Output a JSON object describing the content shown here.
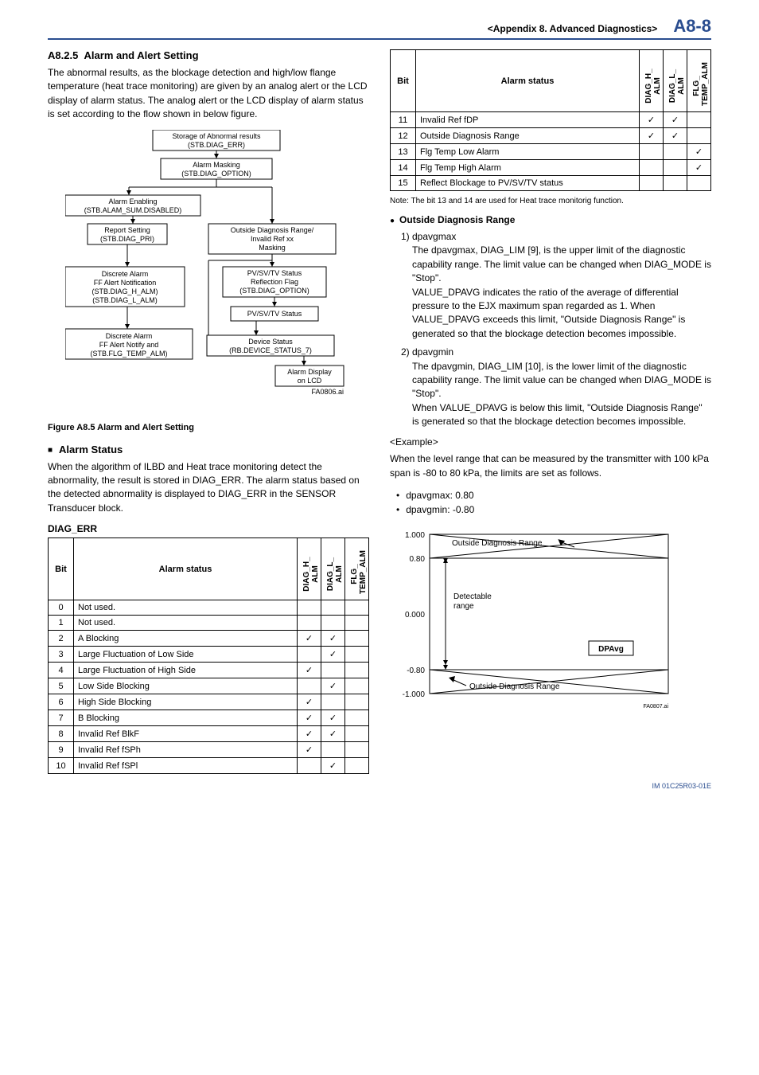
{
  "header": {
    "section": "<Appendix 8.  Advanced Diagnostics>",
    "page": "A8-8"
  },
  "section_no": "A8.2.5",
  "section_title": "Alarm and Alert Setting",
  "intro_para": "The abnormal results, as the blockage detection and high/low flange temperature (heat trace monitoring) are given by an analog alert or the LCD display of alarm status. The analog alert or the LCD display of alarm status is set according to the flow shown in below figure.",
  "flow": {
    "b1": "Storage of Abnormal results\n(STB.DIAG_ERR)",
    "b2": "Alarm Masking\n(STB.DIAG_OPTION)",
    "b3": "Alarm Enabling\n(STB.ALAM_SUM.DISABLED)",
    "b4": "Report Setting\n(STB.DIAG_PRI)",
    "b5": "Outside Diagnosis Range/\nInvalid Ref xx\nMasking",
    "b6": "Discrete Alarm\nFF Alert Notification\n(STB.DIAG_H_ALM)\n(STB.DIAG_L_ALM)",
    "b7": "PV/SV/TV Status\nReflection Flag\n(STB.DIAG_OPTION)",
    "b8": "PV/SV/TV Status",
    "b9": "Discrete Alarm\nFF Alert Notify and\n(STB.FLG_TEMP_ALM)",
    "b10": "Device Status\n(RB.DEVICE_STATUS_7)",
    "b11": "Alarm Display\non LCD",
    "cap": "FA0806.ai"
  },
  "fig_caption": "Figure A8.5    Alarm and Alert Setting",
  "alarm_status_head": "Alarm Status",
  "alarm_status_para": "When the algorithm of ILBD and Heat trace monitoring detect the abnormality, the result is stored in DIAG_ERR. The alarm status based on the detected abnormality is displayed to DIAG_ERR in the SENSOR Transducer block.",
  "diag_err_label": "DIAG_ERR",
  "table_headers": {
    "bit": "Bit",
    "status": "Alarm status",
    "c1": "DIAG_H_\nALM",
    "c2": "DIAG_L_\nALM",
    "c3": "FLG_\nTEMP_ALM"
  },
  "rows_left": [
    {
      "bit": "0",
      "status": "Not used.",
      "c1": "",
      "c2": "",
      "c3": ""
    },
    {
      "bit": "1",
      "status": "Not used.",
      "c1": "",
      "c2": "",
      "c3": ""
    },
    {
      "bit": "2",
      "status": "A Blocking",
      "c1": "✓",
      "c2": "✓",
      "c3": ""
    },
    {
      "bit": "3",
      "status": "Large Fluctuation of Low Side",
      "c1": "",
      "c2": "✓",
      "c3": ""
    },
    {
      "bit": "4",
      "status": "Large Fluctuation of High Side",
      "c1": "✓",
      "c2": "",
      "c3": ""
    },
    {
      "bit": "5",
      "status": "Low Side Blocking",
      "c1": "",
      "c2": "✓",
      "c3": ""
    },
    {
      "bit": "6",
      "status": "High Side Blocking",
      "c1": "✓",
      "c2": "",
      "c3": ""
    },
    {
      "bit": "7",
      "status": "B Blocking",
      "c1": "✓",
      "c2": "✓",
      "c3": ""
    },
    {
      "bit": "8",
      "status": "Invalid Ref BlkF",
      "c1": "✓",
      "c2": "✓",
      "c3": ""
    },
    {
      "bit": "9",
      "status": "Invalid Ref fSPh",
      "c1": "✓",
      "c2": "",
      "c3": ""
    },
    {
      "bit": "10",
      "status": "Invalid Ref fSPl",
      "c1": "",
      "c2": "✓",
      "c3": ""
    }
  ],
  "rows_right": [
    {
      "bit": "11",
      "status": "Invalid Ref fDP",
      "c1": "✓",
      "c2": "✓",
      "c3": ""
    },
    {
      "bit": "12",
      "status": "Outside Diagnosis Range",
      "c1": "✓",
      "c2": "✓",
      "c3": ""
    },
    {
      "bit": "13",
      "status": "Flg Temp Low Alarm",
      "c1": "",
      "c2": "",
      "c3": "✓"
    },
    {
      "bit": "14",
      "status": "Flg Temp High Alarm",
      "c1": "",
      "c2": "",
      "c3": "✓"
    },
    {
      "bit": "15",
      "status": "Reflect Blockage to PV/SV/TV status",
      "c1": "",
      "c2": "",
      "c3": ""
    }
  ],
  "note_text": "Note:  The bit 13 and 14 are used for Heat trace monitorig function.",
  "outside_head": "Outside Diagnosis Range",
  "odr_1_label": "1) dpavgmax",
  "odr_1_p1": "The dpavgmax, DIAG_LIM [9], is the upper limit of the diagnostic capability range. The limit value can be changed when DIAG_MODE is \"Stop\".",
  "odr_1_p2": "VALUE_DPAVG indicates the ratio of the average of differential pressure to the EJX maximum span regarded as 1. When VALUE_DPAVG exceeds this limit, \"Outside Diagnosis Range\" is generated so that the blockage detection becomes impossible.",
  "odr_2_label": "2) dpavgmin",
  "odr_2_p1": "The dpavgmin, DIAG_LIM [10], is the lower limit of the diagnostic capability range. The limit value can be changed when DIAG_MODE is \"Stop\".",
  "odr_2_p2": "When VALUE_DPAVG is below this limit, \"Outside Diagnosis Range\" is generated so that the blockage detection becomes impossible.",
  "example_label": "<Example>",
  "example_para": "When the level range that can be measured by the transmitter with 100 kPa span is -80 to 80 kPa, the limits are set as follows.",
  "example_bullets": [
    "dpavgmax: 0.80",
    "dpavgmin: -0.80"
  ],
  "chart_data": {
    "type": "diagram",
    "y_ticks": [
      "1.000",
      "0.80",
      "0.000",
      "-0.80",
      "-1.000"
    ],
    "labels": {
      "top": "Outside Diagnosis Range",
      "mid": "Detectable\nrange",
      "dp": "DPAvg",
      "bot": "Outside Diagnosis Range"
    },
    "caption": "FA0807.ai"
  },
  "footer": "IM 01C25R03-01E"
}
